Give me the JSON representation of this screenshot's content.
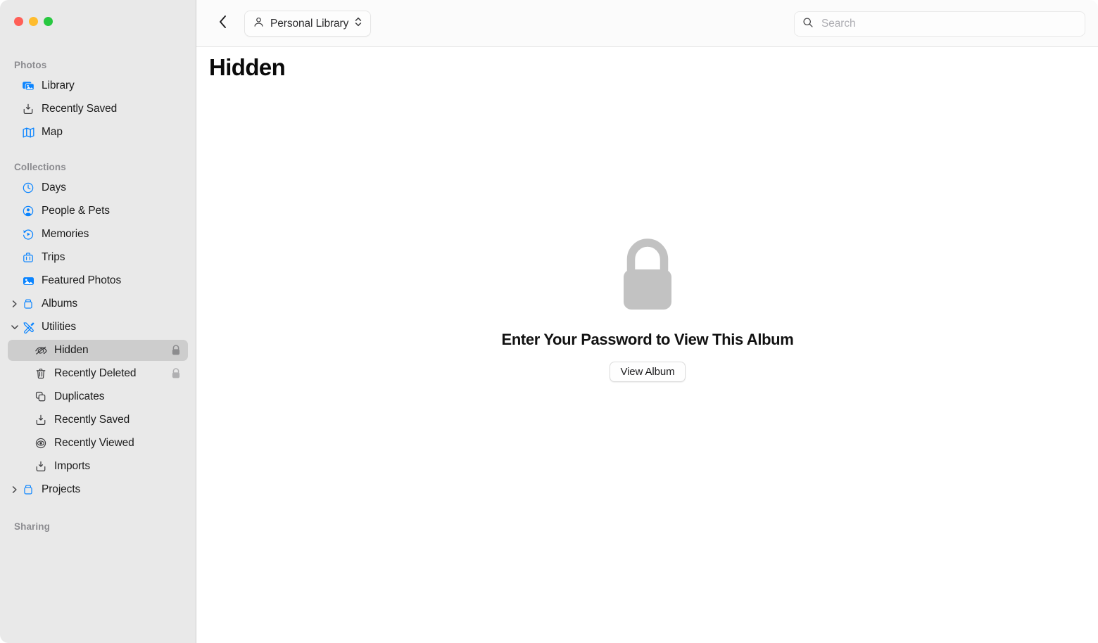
{
  "window": {
    "traffic_lights": [
      {
        "name": "close",
        "color": "#ff5f57"
      },
      {
        "name": "minimize",
        "color": "#febc2e"
      },
      {
        "name": "maximize",
        "color": "#28c840"
      }
    ]
  },
  "toolbar": {
    "back_icon": "chevron-left-icon",
    "library_popup": {
      "icon": "person-icon",
      "label": "Personal Library",
      "indicator": "up-down-chevron-icon"
    },
    "search": {
      "icon": "search-icon",
      "placeholder": "Search",
      "value": ""
    }
  },
  "sidebar": {
    "sections": [
      {
        "label": "Photos",
        "items": [
          {
            "label": "Library",
            "icon": "photo-stack-icon",
            "icon_style": "blue-filled",
            "level": 0,
            "selected": false,
            "locked": false,
            "disclosure": null
          },
          {
            "label": "Recently Saved",
            "icon": "save-down-icon",
            "icon_style": "gray-outline",
            "level": 0,
            "selected": false,
            "locked": false,
            "disclosure": null
          },
          {
            "label": "Map",
            "icon": "map-icon",
            "icon_style": "blue-outline",
            "level": 0,
            "selected": false,
            "locked": false,
            "disclosure": null
          }
        ]
      },
      {
        "label": "Collections",
        "items": [
          {
            "label": "Days",
            "icon": "clock-icon",
            "icon_style": "blue-outline",
            "level": 0,
            "selected": false,
            "locked": false,
            "disclosure": null
          },
          {
            "label": "People & Pets",
            "icon": "person-circle-icon",
            "icon_style": "blue-filled",
            "level": 0,
            "selected": false,
            "locked": false,
            "disclosure": null
          },
          {
            "label": "Memories",
            "icon": "memories-icon",
            "icon_style": "blue-outline",
            "level": 0,
            "selected": false,
            "locked": false,
            "disclosure": null
          },
          {
            "label": "Trips",
            "icon": "suitcase-icon",
            "icon_style": "blue-outline",
            "level": 0,
            "selected": false,
            "locked": false,
            "disclosure": null
          },
          {
            "label": "Featured Photos",
            "icon": "featured-photo-icon",
            "icon_style": "blue-filled",
            "level": 0,
            "selected": false,
            "locked": false,
            "disclosure": null
          },
          {
            "label": "Albums",
            "icon": "album-box-icon",
            "icon_style": "blue-outline",
            "level": 0,
            "selected": false,
            "locked": false,
            "disclosure": "collapsed"
          },
          {
            "label": "Utilities",
            "icon": "tools-icon",
            "icon_style": "blue-outline",
            "level": 0,
            "selected": false,
            "locked": false,
            "disclosure": "expanded"
          },
          {
            "label": "Hidden",
            "icon": "eye-slash-icon",
            "icon_style": "gray-outline",
            "level": 1,
            "selected": true,
            "locked": true,
            "disclosure": null
          },
          {
            "label": "Recently Deleted",
            "icon": "trash-icon",
            "icon_style": "gray-outline",
            "level": 1,
            "selected": false,
            "locked": true,
            "disclosure": null
          },
          {
            "label": "Duplicates",
            "icon": "duplicate-icon",
            "icon_style": "gray-outline",
            "level": 1,
            "selected": false,
            "locked": false,
            "disclosure": null
          },
          {
            "label": "Recently Saved",
            "icon": "save-down-icon",
            "icon_style": "gray-outline",
            "level": 1,
            "selected": false,
            "locked": false,
            "disclosure": null
          },
          {
            "label": "Recently Viewed",
            "icon": "eye-icon",
            "icon_style": "gray-outline",
            "level": 1,
            "selected": false,
            "locked": false,
            "disclosure": null
          },
          {
            "label": "Imports",
            "icon": "save-down-icon",
            "icon_style": "gray-outline",
            "level": 1,
            "selected": false,
            "locked": false,
            "disclosure": null
          },
          {
            "label": "Projects",
            "icon": "album-box-icon",
            "icon_style": "blue-outline",
            "level": 0,
            "selected": false,
            "locked": false,
            "disclosure": "collapsed"
          }
        ]
      },
      {
        "label": "Sharing",
        "items": []
      }
    ]
  },
  "main": {
    "page_title": "Hidden",
    "empty_state": {
      "icon": "lock-icon",
      "title": "Enter Your Password to View This Album",
      "button_label": "View Album"
    }
  },
  "colors": {
    "accent_blue": "#0a84ff",
    "sidebar_bg": "#e9e9e9",
    "selected_row": "#cdcdcd",
    "lock_gray": "#c2c2c2"
  }
}
